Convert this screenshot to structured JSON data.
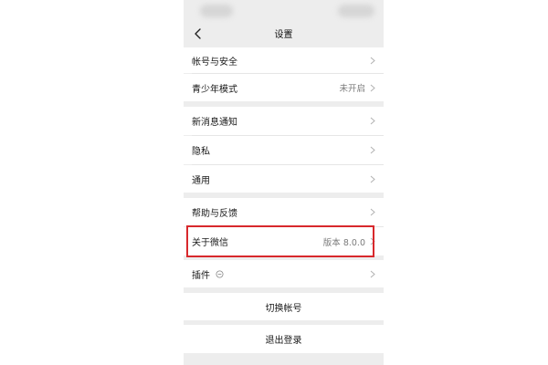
{
  "header": {
    "title": "设置"
  },
  "groups": [
    {
      "rows": [
        {
          "label": "帐号与安全"
        },
        {
          "label": "青少年模式",
          "value": "未开启"
        }
      ]
    },
    {
      "rows": [
        {
          "label": "新消息通知"
        },
        {
          "label": "隐私"
        },
        {
          "label": "通用"
        }
      ]
    },
    {
      "rows": [
        {
          "label": "帮助与反馈"
        },
        {
          "label": "关于微信",
          "value": "版本 8.0.0"
        }
      ]
    },
    {
      "rows": [
        {
          "label": "插件"
        }
      ]
    }
  ],
  "actions": {
    "switch_account": "切换帐号",
    "logout": "退出登录"
  },
  "icons": {
    "back": "chevron-left-icon",
    "row_arrow": "chevron-right-icon",
    "plugin": "circle-minus-icon"
  },
  "colors": {
    "background": "#ededed",
    "row": "#ffffff",
    "highlight": "#d8282c"
  }
}
